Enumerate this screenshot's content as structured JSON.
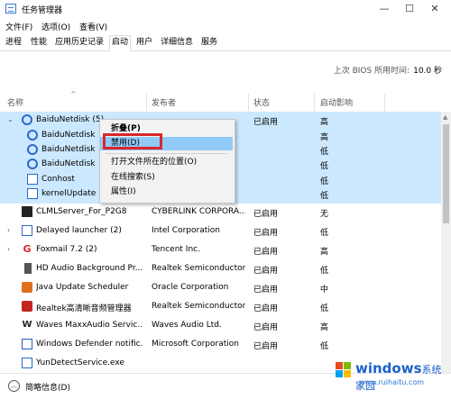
{
  "window": {
    "title": "任务管理器",
    "minimize": "—",
    "maximize": "☐",
    "close": "✕"
  },
  "menu": [
    "文件(F)",
    "选项(O)",
    "查看(V)"
  ],
  "tabs": [
    "进程",
    "性能",
    "应用历史记录",
    "启动",
    "用户",
    "详细信息",
    "服务"
  ],
  "active_tab": "启动",
  "bios": {
    "label": "上次 BIOS 所用时间:",
    "value": "10.0 秒"
  },
  "columns": {
    "name": "名称",
    "publisher": "发布者",
    "status": "状态",
    "impact": "启动影响"
  },
  "rows": [
    {
      "name": "BaiduNetdisk (5)",
      "publisher": "",
      "status": "已启用",
      "impact": "高",
      "icon": "baidu-icon",
      "expanded": true
    },
    {
      "name": "BaiduNetdisk",
      "publisher": "",
      "status": "",
      "impact": "高",
      "icon": "baidu-icon"
    },
    {
      "name": "BaiduNetdisk",
      "publisher": "",
      "status": "",
      "impact": "低",
      "icon": "baidu-icon"
    },
    {
      "name": "BaiduNetdisk",
      "publisher": "",
      "status": "",
      "impact": "低",
      "icon": "baidu-icon"
    },
    {
      "name": "Conhost",
      "publisher": "",
      "status": "",
      "impact": "低",
      "icon": "app-box-icon"
    },
    {
      "name": "kernelUpdate",
      "publisher": "",
      "status": "",
      "impact": "低",
      "icon": "app-box-icon"
    },
    {
      "name": "CLMLServer_For_P2G8",
      "publisher": "CYBERLINK CORPORA...",
      "status": "已启用",
      "impact": "无",
      "icon": "clml-icon"
    },
    {
      "name": "Delayed launcher (2)",
      "publisher": "Intel Corporation",
      "status": "已启用",
      "impact": "低",
      "icon": "app-box-icon"
    },
    {
      "name": "Foxmail 7.2 (2)",
      "publisher": "Tencent Inc.",
      "status": "已启用",
      "impact": "高",
      "icon": "foxmail-icon"
    },
    {
      "name": "HD Audio Background Pr...",
      "publisher": "Realtek Semiconductor",
      "status": "已启用",
      "impact": "低",
      "icon": "speaker-icon"
    },
    {
      "name": "Java Update Scheduler",
      "publisher": "Oracle Corporation",
      "status": "已启用",
      "impact": "中",
      "icon": "java-icon"
    },
    {
      "name": "Realtek高清晰音频管理器",
      "publisher": "Realtek Semiconductor",
      "status": "已启用",
      "impact": "低",
      "icon": "realtek-icon"
    },
    {
      "name": "Waves MaxxAudio Servic...",
      "publisher": "Waves Audio Ltd.",
      "status": "已启用",
      "impact": "高",
      "icon": "waves-icon"
    },
    {
      "name": "Windows Defender notific...",
      "publisher": "Microsoft Corporation",
      "status": "已启用",
      "impact": "低",
      "icon": "windows-defender-icon"
    },
    {
      "name": "YunDetectService.exe",
      "publisher": "",
      "status": "",
      "impact": "",
      "icon": "app-box-icon"
    }
  ],
  "context_menu": [
    "折叠(P)",
    "禁用(D)",
    "打开文件所在的位置(O)",
    "在线搜索(S)",
    "属性(I)"
  ],
  "footer": {
    "label": "简略信息(D)"
  },
  "watermark": {
    "title": "windows",
    "subtitle": "系统家园",
    "url": "www.ruihaitu.com"
  }
}
